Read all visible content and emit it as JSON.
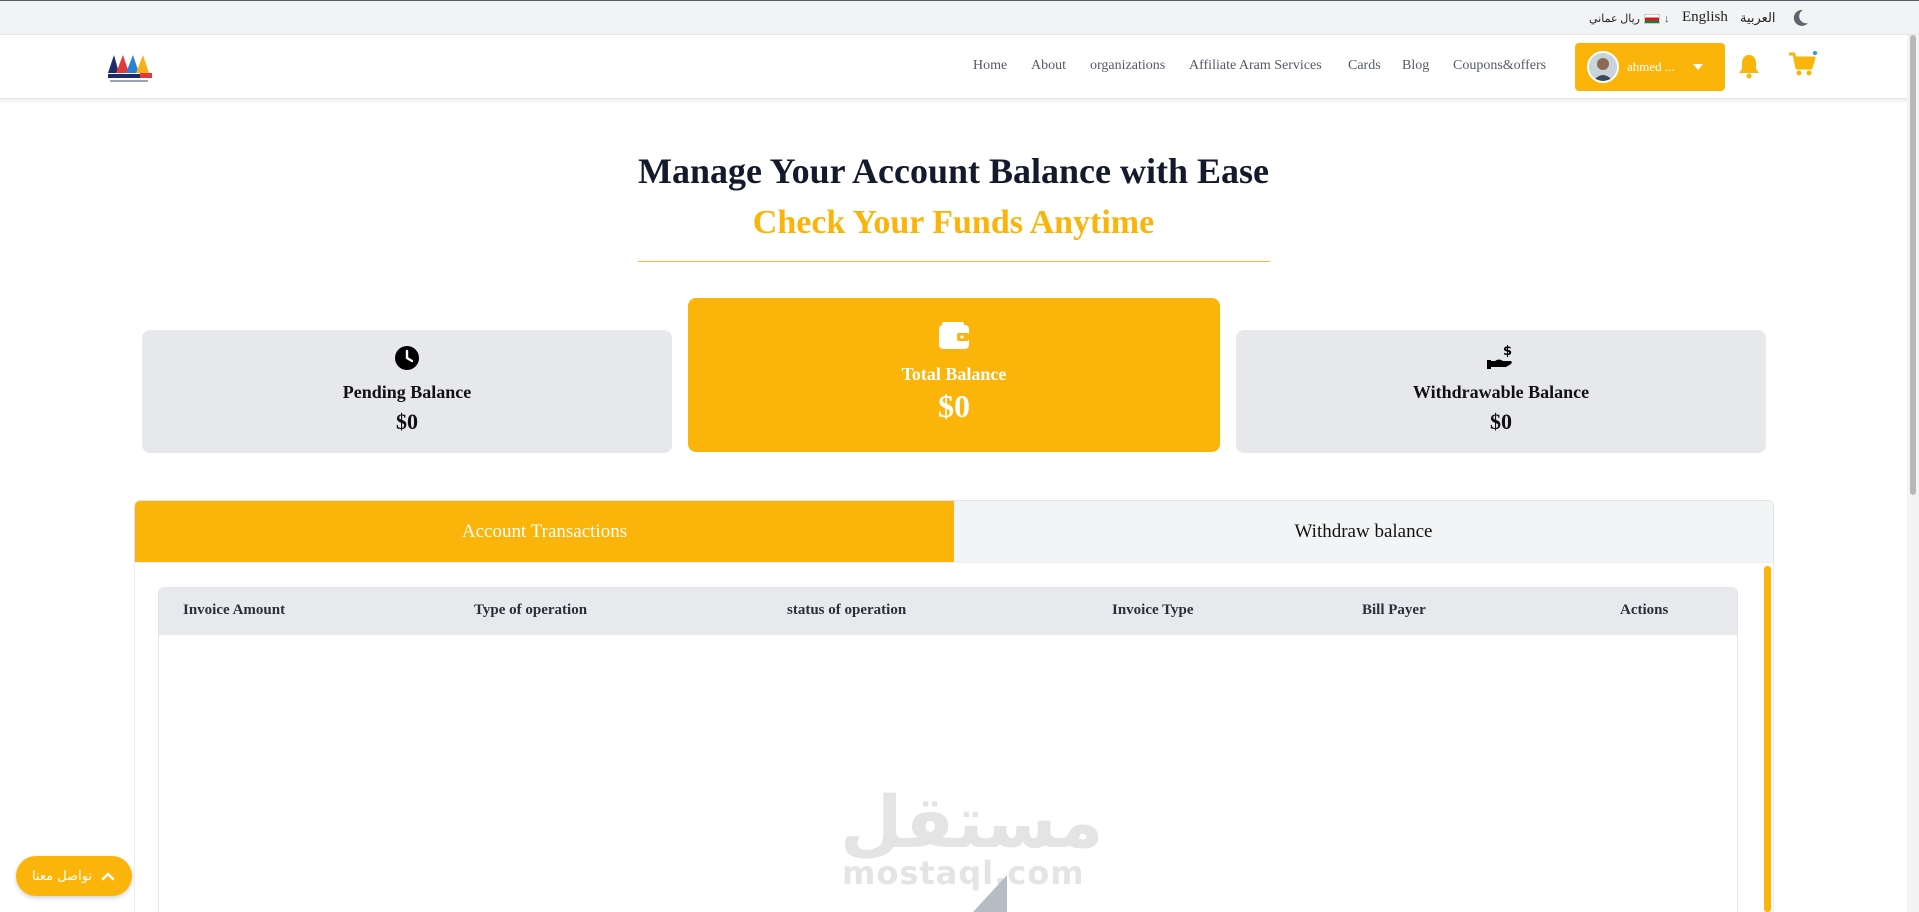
{
  "top_bar": {
    "currency": "ريال عماني",
    "language_english": "English",
    "language_arabic": "العربية"
  },
  "header": {
    "nav": [
      "Home",
      "About",
      "organizations",
      "Affiliate Aram Services",
      "Cards",
      "Blog",
      "Coupons&offers"
    ],
    "user_name": "ahmed ..."
  },
  "hero": {
    "title": "Manage Your Account Balance with Ease",
    "subtitle": "Check Your Funds Anytime"
  },
  "balances": {
    "pending_label": "Pending Balance",
    "pending_value": "$0",
    "total_label": "Total Balance",
    "total_value": "$0",
    "withdrawable_label": "Withdrawable Balance",
    "withdrawable_value": "$0"
  },
  "tabs": {
    "transactions": "Account Transactions",
    "withdraw": "Withdraw balance"
  },
  "table": {
    "columns": [
      "Invoice Amount",
      "Type of operation",
      "status of operation",
      "Invoice Type",
      "Bill Payer",
      "Actions"
    ]
  },
  "watermark": {
    "arabic": "مستقل",
    "latin": "mostaql.com"
  },
  "contact": {
    "label": "تواصل معنا"
  },
  "colors": {
    "accent": "#fbb50a",
    "heading": "#131a2b",
    "card_bg": "#e7e8eb"
  }
}
